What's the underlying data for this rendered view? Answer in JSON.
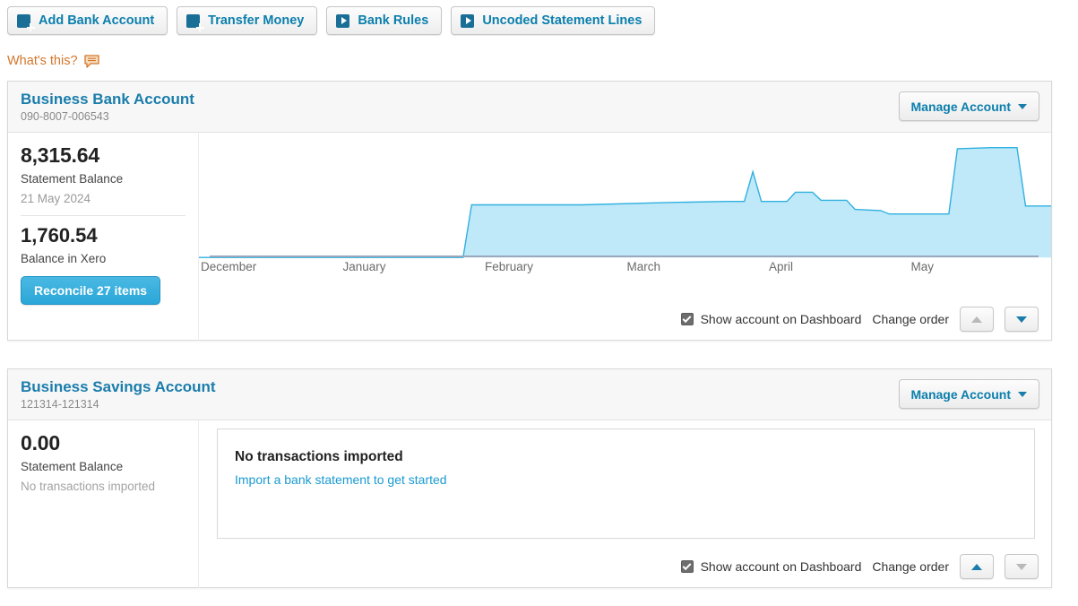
{
  "toolbar": {
    "buttons": [
      {
        "label": "Add Bank Account",
        "icon": "plus-icon"
      },
      {
        "label": "Transfer Money",
        "icon": "plus-icon"
      },
      {
        "label": "Bank Rules",
        "icon": "play-icon"
      },
      {
        "label": "Uncoded Statement Lines",
        "icon": "play-icon"
      }
    ]
  },
  "help": {
    "label": "What's this?",
    "icon": "speech-bubble-icon",
    "color": "#d4762a"
  },
  "colors": {
    "link": "#1a7dab",
    "button_text": "#0b7fad",
    "chart_fill": "#bfe9f8",
    "chart_stroke": "#31b0e0",
    "reconcile_button": "#2aa6d8",
    "axis": "#9aa7bd"
  },
  "accounts": [
    {
      "name": "Business Bank Account",
      "number": "090-8007-006543",
      "manage_label": "Manage Account",
      "statement_balance": "8,315.64",
      "statement_balance_label": "Statement Balance",
      "statement_date": "21 May 2024",
      "xero_balance": "1,760.54",
      "xero_balance_label": "Balance in Xero",
      "reconcile_label": "Reconcile 27 items",
      "show_on_dashboard_label": "Show account on Dashboard",
      "show_on_dashboard_checked": true,
      "change_order_label": "Change order",
      "order_up_enabled": false,
      "order_down_enabled": true
    },
    {
      "name": "Business Savings Account",
      "number": "121314-121314",
      "manage_label": "Manage Account",
      "statement_balance": "0.00",
      "statement_balance_label": "Statement Balance",
      "statement_note": "No transactions imported",
      "empty_title": "No transactions imported",
      "empty_link": "Import a bank statement to get started",
      "show_on_dashboard_label": "Show account on Dashboard",
      "show_on_dashboard_checked": true,
      "change_order_label": "Change order",
      "order_up_enabled": true,
      "order_down_enabled": false
    }
  ],
  "chart_data": {
    "type": "area",
    "title": "",
    "xlabel": "",
    "ylabel": "",
    "grid": false,
    "legend": "none",
    "categories": [
      "December",
      "January",
      "February",
      "March",
      "April",
      "May"
    ],
    "xlim": [
      0,
      100
    ],
    "ylim": [
      0,
      100
    ],
    "series": [
      {
        "name": "Statement Balance",
        "points": [
          [
            0,
            0
          ],
          [
            31,
            0
          ],
          [
            32,
            46
          ],
          [
            45,
            46
          ],
          [
            55,
            48
          ],
          [
            62,
            49
          ],
          [
            64,
            49
          ],
          [
            65,
            75
          ],
          [
            66,
            49
          ],
          [
            69,
            49
          ],
          [
            70,
            57
          ],
          [
            72,
            57
          ],
          [
            73,
            50
          ],
          [
            76,
            50
          ],
          [
            77,
            42
          ],
          [
            80,
            41
          ],
          [
            81,
            38
          ],
          [
            87,
            38
          ],
          [
            88,
            38
          ],
          [
            89,
            95
          ],
          [
            93,
            96
          ],
          [
            96,
            96
          ],
          [
            97,
            45
          ],
          [
            104,
            45
          ],
          [
            105,
            43
          ],
          [
            107,
            33
          ],
          [
            112,
            33
          ],
          [
            113,
            30
          ],
          [
            118,
            30
          ],
          [
            120,
            30
          ]
        ]
      }
    ]
  }
}
